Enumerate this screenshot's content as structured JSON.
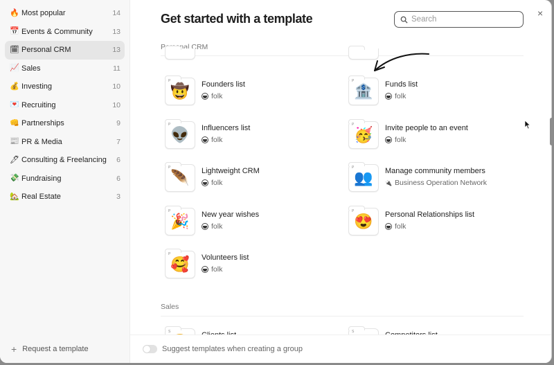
{
  "sidebar": {
    "categories": [
      {
        "icon": "🔥",
        "label": "Most popular",
        "count": "14"
      },
      {
        "icon": "📅",
        "label": "Events & Community",
        "count": "13"
      },
      {
        "icon": "🗓",
        "label": "Personal CRM",
        "count": "13",
        "active": true
      },
      {
        "icon": "📈",
        "label": "Sales",
        "count": "11"
      },
      {
        "icon": "💰",
        "label": "Investing",
        "count": "10"
      },
      {
        "icon": "💌",
        "label": "Recruiting",
        "count": "10"
      },
      {
        "icon": "👊",
        "label": "Partnerships",
        "count": "9"
      },
      {
        "icon": "📰",
        "label": "PR & Media",
        "count": "7"
      },
      {
        "icon": "🖊",
        "label": "Consulting & Freelancing",
        "count": "6"
      },
      {
        "icon": "💸",
        "label": "Fundraising",
        "count": "6"
      },
      {
        "icon": "🏡",
        "label": "Real Estate",
        "count": "3"
      }
    ],
    "request_label": "Request a template"
  },
  "header": {
    "title": "Get started with a template",
    "search_placeholder": "Search",
    "close": "×"
  },
  "sections": [
    {
      "label": "Personal CRM",
      "tag": "P",
      "templates": [
        {
          "icon": "🤠",
          "name": "Founders list",
          "owner": "folk"
        },
        {
          "icon": "🏦",
          "name": "Funds list",
          "owner": "folk"
        },
        {
          "icon": "👽",
          "name": "Influencers list",
          "owner": "folk"
        },
        {
          "icon": "🥳",
          "name": "Invite people to an event",
          "owner": "folk"
        },
        {
          "icon": "🪶",
          "name": "Lightweight CRM",
          "owner": "folk"
        },
        {
          "icon": "👥",
          "name": "Manage community members",
          "owner": "Business Operation Network",
          "owner_icon": "🔌"
        },
        {
          "icon": "🎉",
          "name": "New year wishes",
          "owner": "folk"
        },
        {
          "icon": "😍",
          "name": "Personal Relationships list",
          "owner": "folk"
        },
        {
          "icon": "🥰",
          "name": "Volunteers list",
          "owner": "folk"
        }
      ]
    },
    {
      "label": "Sales",
      "tag": "S",
      "templates": [
        {
          "icon": "😊",
          "name": "Clients list"
        },
        {
          "icon": "⋮⋮⋮",
          "name": "Competitors list"
        }
      ]
    }
  ],
  "footer": {
    "toggle_label": "Suggest templates when creating a group",
    "toggle_on": false
  }
}
